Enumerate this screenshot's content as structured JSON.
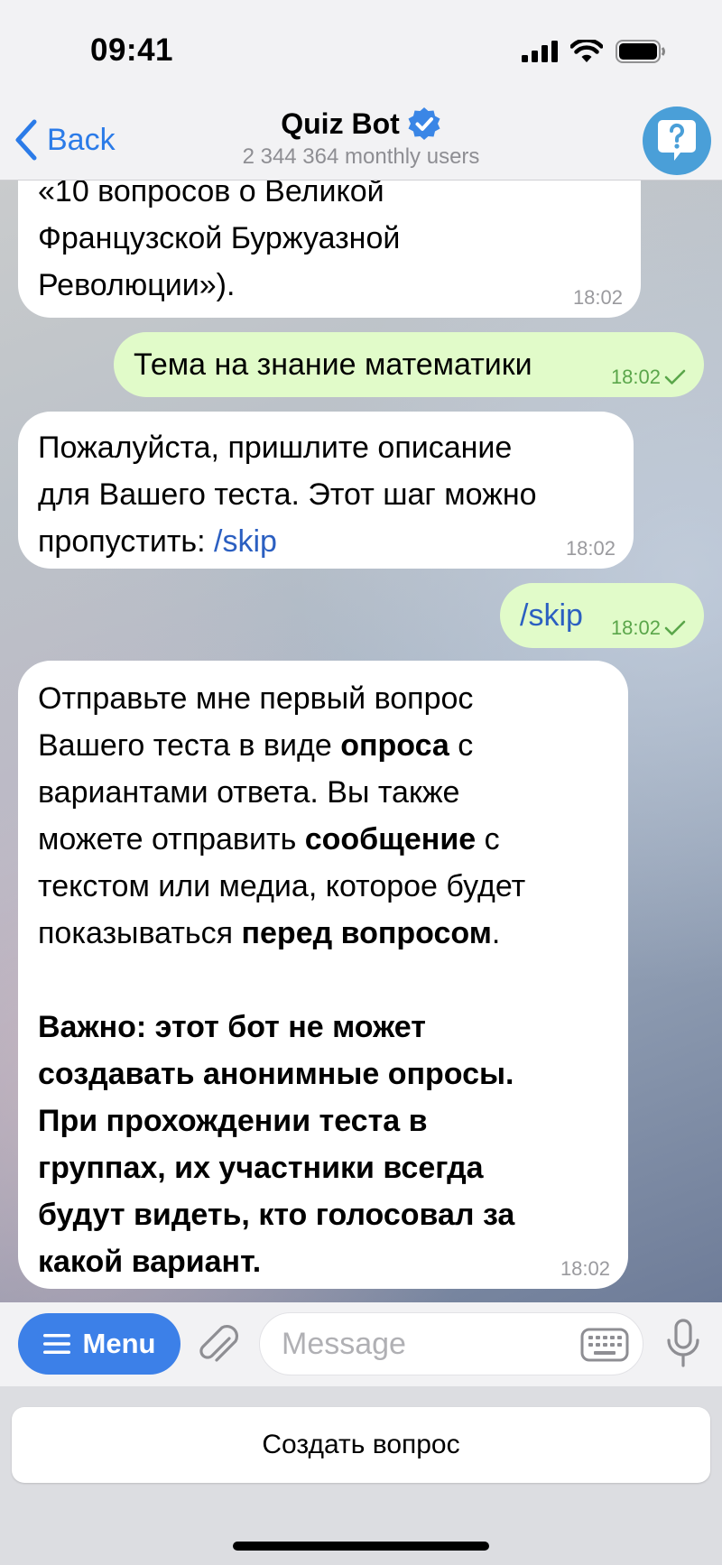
{
  "status_bar": {
    "time": "09:41"
  },
  "header": {
    "back_label": "Back",
    "title": "Quiz Bot",
    "subtitle": "2 344 364 monthly users",
    "verified": true,
    "help_icon": "question-bubble-icon"
  },
  "messages": [
    {
      "direction": "in",
      "lines": [
        "«10 вопросов о Великой",
        "Французской Буржуазной",
        "Революции»)."
      ],
      "time": "18:02"
    },
    {
      "direction": "out",
      "text": "Тема на знание математики",
      "time": "18:02",
      "read": true
    },
    {
      "direction": "in",
      "lines": [
        "Пожалуйста, пришлите описание",
        "для Вашего теста. Этот шаг можно",
        "пропустить: "
      ],
      "link": "/skip",
      "time": "18:02"
    },
    {
      "direction": "out",
      "text": "/skip",
      "time": "18:02",
      "read": true
    },
    {
      "direction": "in",
      "p1": {
        "l1": "Отправьте мне первый вопрос",
        "l2a": "Вашего теста в виде ",
        "l2b": "опроса",
        "l2c": " с",
        "l3": "вариантами ответа. Вы также",
        "l4a": "можете отправить ",
        "l4b": "сообщение",
        "l4c": " с",
        "l5": "текстом или медиа, которое будет",
        "l6a": "показываться ",
        "l6b": "перед вопросом",
        "l6c": "."
      },
      "p2": [
        "Важно: этот бот не может",
        "создавать анонимные опросы.",
        "При прохождении теста в",
        "группах, их участники всегда",
        "будут видеть, кто голосовал за",
        "какой вариант."
      ],
      "time": "18:02"
    }
  ],
  "composer": {
    "menu_label": "Menu",
    "placeholder": "Message"
  },
  "keyboard": {
    "button_label": "Создать вопрос"
  },
  "colors": {
    "accent": "#3c80e8",
    "link": "#2b5fc1",
    "outgoing_bubble": "#e1fbc9",
    "incoming_bubble": "#ffffff",
    "read_check": "#5aa64a"
  }
}
